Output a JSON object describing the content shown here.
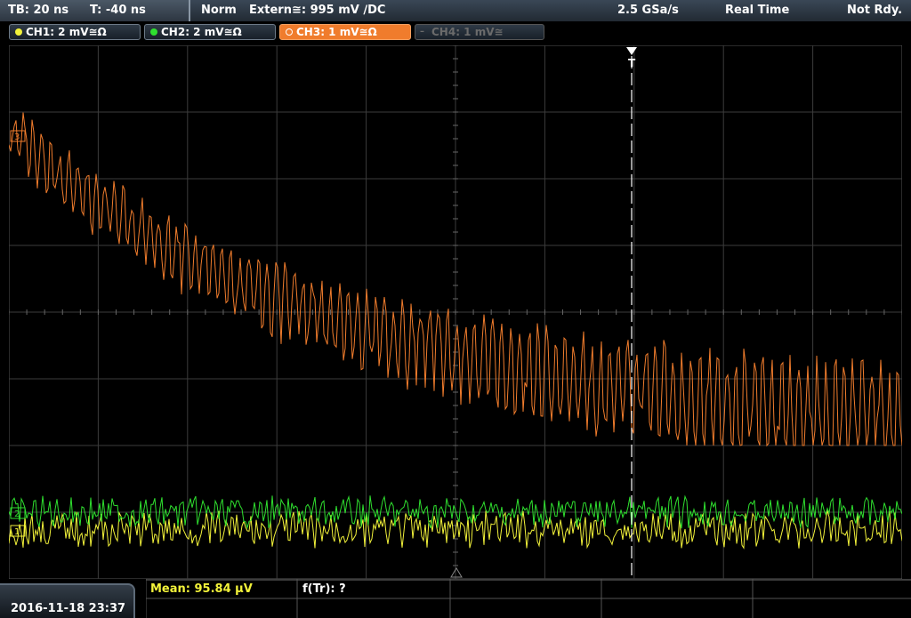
{
  "header": {
    "timebase": "TB: 20 ns",
    "trigger_time": "T: -40 ns",
    "mode": "Norm",
    "trigger_source": "Extern≅: 995 mV ∕DC",
    "sample_rate": "2.5 GSa/s",
    "acq_mode": "Real Time",
    "status": "Not Rdy."
  },
  "channels": [
    {
      "label": "CH1: 2 mV≅Ω",
      "color": "#f2f23a",
      "active": true
    },
    {
      "label": "CH2: 2 mV≅Ω",
      "color": "#2fe02f",
      "active": true
    },
    {
      "label": "CH3: 1 mV≅Ω",
      "color": "#f07c2c",
      "active": true,
      "selected": true
    },
    {
      "label": "CH4: 1 mV≅",
      "color": "#6b6b6b",
      "active": false
    }
  ],
  "markers": {
    "trigger": "T",
    "ch1": "1",
    "ch2": "2",
    "ch3": "3"
  },
  "footer": {
    "datetime": "2016-11-18 23:37",
    "mean": "Mean: 95.84 µV",
    "freq": "f(Tr): ?"
  },
  "colors": {
    "ch1": "#f2f23a",
    "ch2": "#2fe02f",
    "ch3": "#f07c2c",
    "grid": "#3c3c3c"
  }
}
